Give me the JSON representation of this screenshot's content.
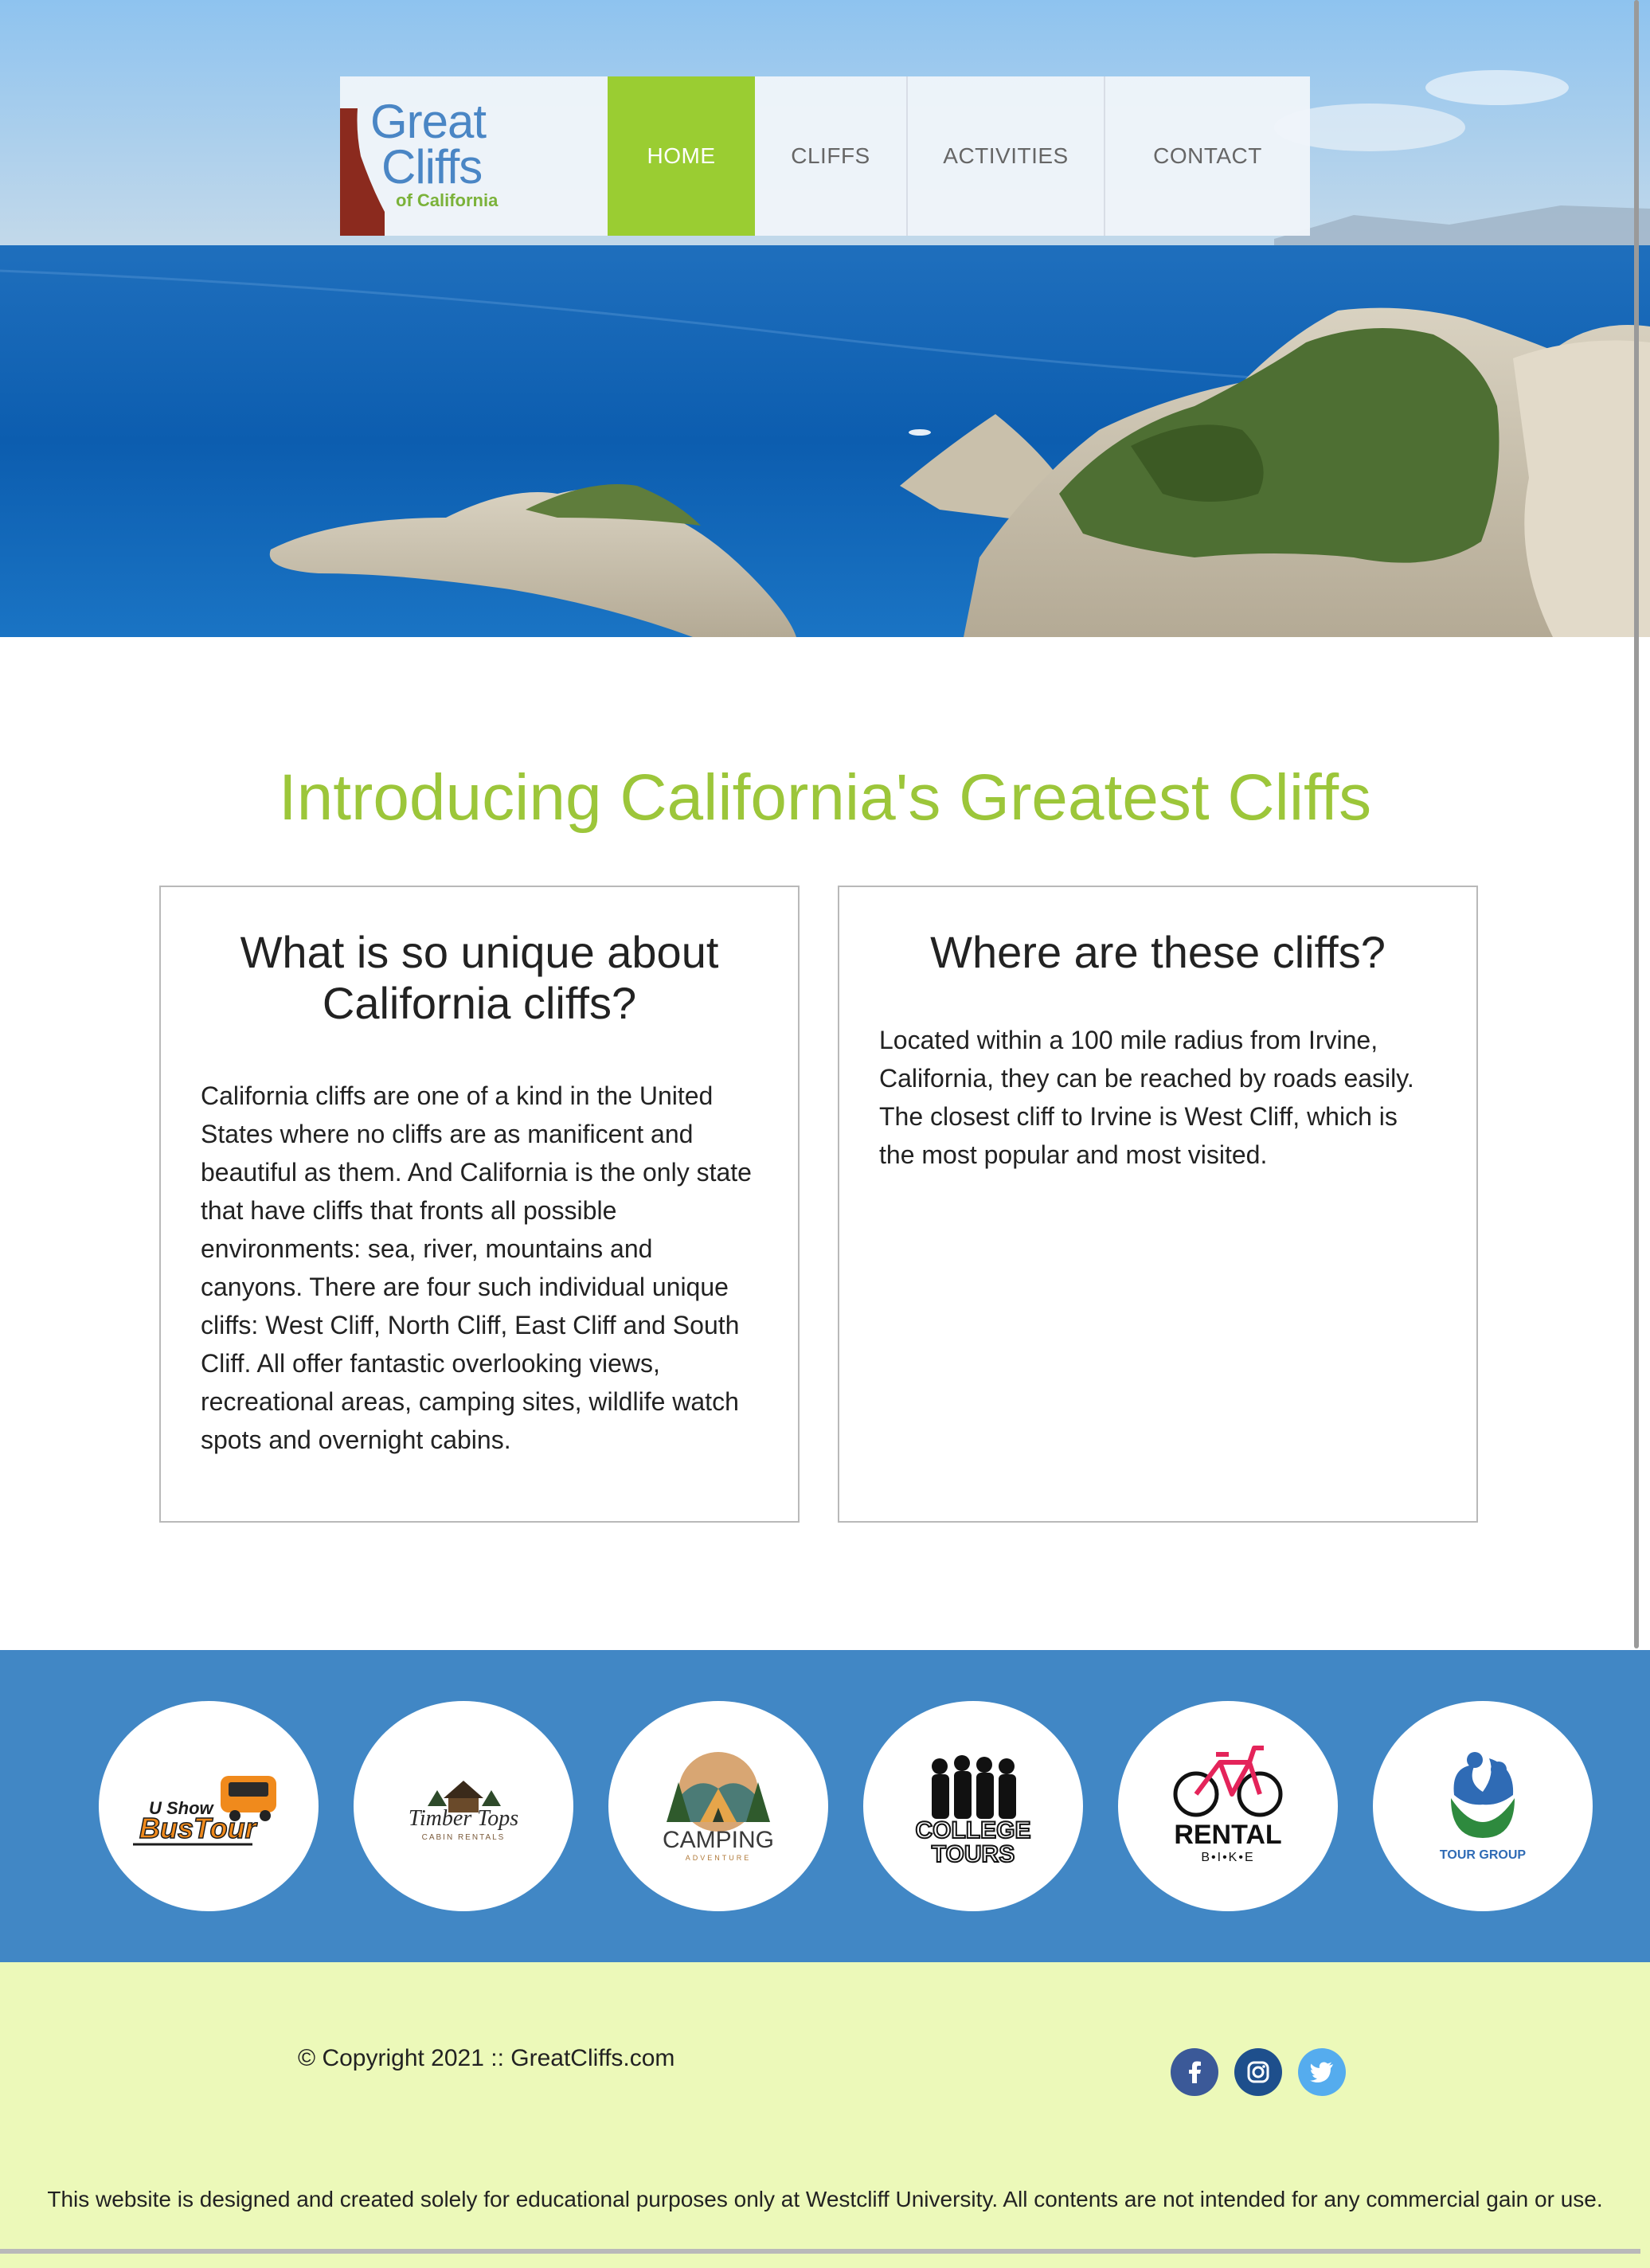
{
  "brand": {
    "logo_line1": "Great",
    "logo_line2": "Cliffs",
    "logo_line3": "of California",
    "colors": {
      "accent_green": "#9acd32",
      "title_green": "#9cc63a",
      "logo_blue": "#4a86c5",
      "partners_band": "#4187c5",
      "footer_bg": "#ecf9b9"
    }
  },
  "nav": {
    "items": [
      {
        "label": "HOME",
        "active": true
      },
      {
        "label": "CLIFFS",
        "active": false
      },
      {
        "label": "ACTIVITIES",
        "active": false
      },
      {
        "label": "CONTACT",
        "active": false
      }
    ]
  },
  "intro": {
    "title": "Introducing California's Greatest Cliffs",
    "cards": [
      {
        "heading": "What is so unique about California cliffs?",
        "body": "California cliffs are one of a kind in the United States where no cliffs are as manificent and beautiful as them. And California is the only state that have cliffs that fronts all possible environments: sea, river, mountains and canyons. There are four such individual unique cliffs: West Cliff, North Cliff, East Cliff and South Cliff. All offer fantastic overlooking views, recreational areas, camping sites, wildlife watch spots and overnight cabins."
      },
      {
        "heading": "Where are these cliffs?",
        "body": "Located within a 100 mile radius from Irvine, California, they can be reached by roads easily. The closest cliff to Irvine is West Cliff, which is the most popular and most visited."
      }
    ]
  },
  "partners": [
    {
      "icon": "bus-tour-logo",
      "line1": "U Show",
      "line2": "BusTour"
    },
    {
      "icon": "timber-tops-logo",
      "line1": "Timber Tops",
      "line2": "CABIN RENTALS"
    },
    {
      "icon": "camping-logo",
      "line1": "CAMPING",
      "line2": "ADVENTURE"
    },
    {
      "icon": "college-tours-logo",
      "line1": "COLLEGE",
      "line2": "TOURS"
    },
    {
      "icon": "rental-bike-logo",
      "line1": "RENTAL",
      "line2": "B•I•K•E"
    },
    {
      "icon": "tour-group-logo",
      "line1": "TOUR GROUP",
      "line2": ""
    }
  ],
  "footer": {
    "copyright": "© Copyright 2021 :: GreatCliffs.com",
    "social": [
      "facebook-icon",
      "instagram-icon",
      "twitter-icon"
    ],
    "disclaimer": "This website is designed and created solely for educational purposes only at Westcliff University. All contents are not intended for any commercial gain or use."
  }
}
